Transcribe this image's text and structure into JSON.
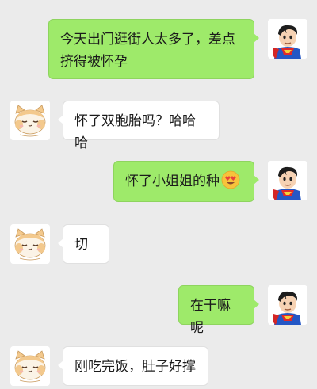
{
  "messages": [
    {
      "sender": "me",
      "avatar": "superman-avatar",
      "text": "今天出门逛街人太多了，差点挤得被怀孕"
    },
    {
      "sender": "other",
      "avatar": "cat-avatar",
      "text": "怀了双胞胎吗？哈哈哈"
    },
    {
      "sender": "me",
      "avatar": "superman-avatar",
      "text": "怀了小姐姐的种",
      "emoji": "heart-eyes-emoji"
    },
    {
      "sender": "other",
      "avatar": "cat-avatar",
      "text": "切"
    },
    {
      "sender": "me",
      "avatar": "superman-avatar",
      "text": "在干嘛呢"
    },
    {
      "sender": "other",
      "avatar": "cat-avatar",
      "text": "刚吃完饭，肚子好撑"
    }
  ],
  "colors": {
    "background": "#ebebeb",
    "my_bubble": "#9eea6a",
    "other_bubble": "#ffffff"
  }
}
